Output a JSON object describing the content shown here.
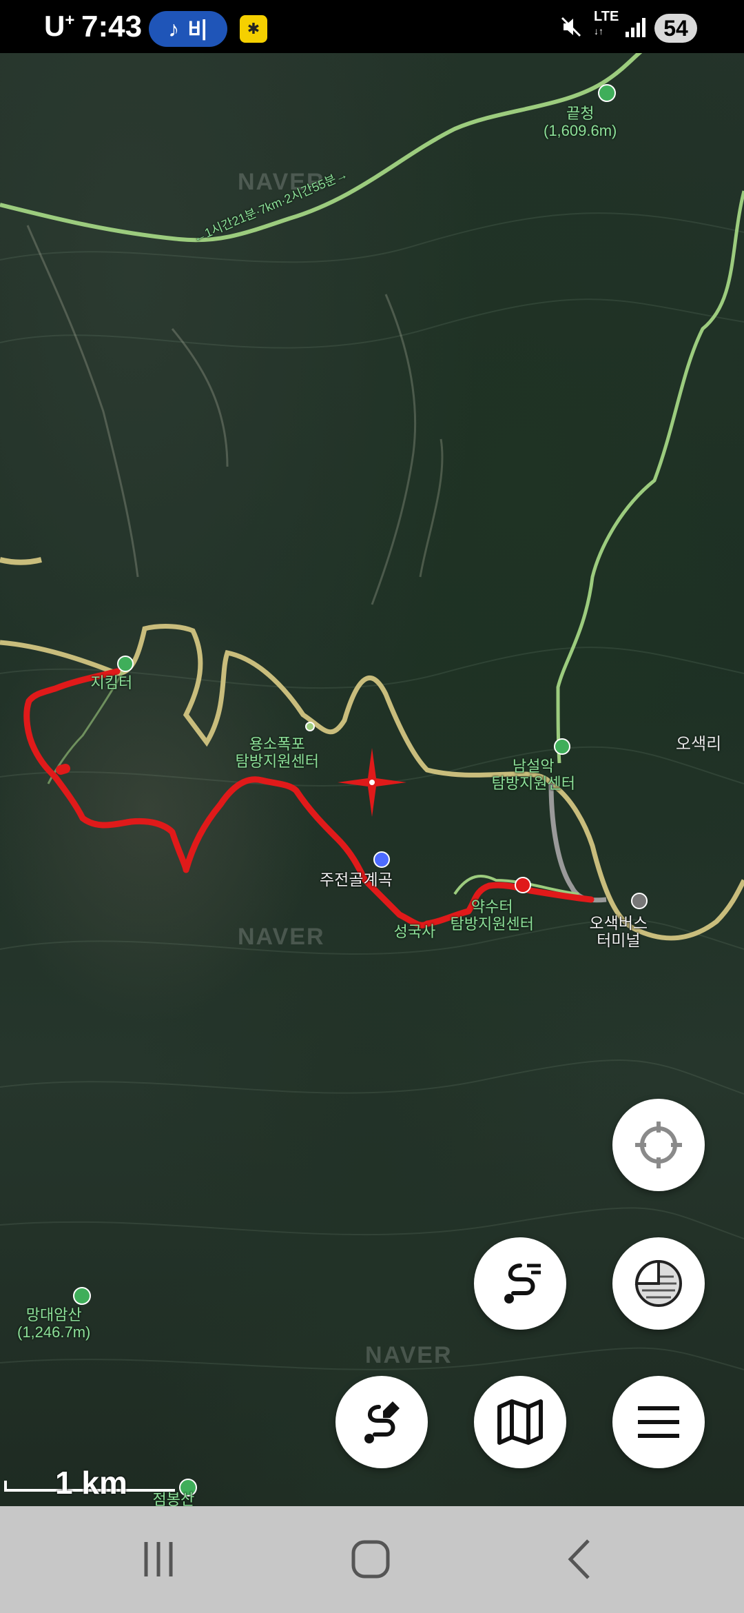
{
  "status_bar": {
    "carrier": "U",
    "carrier_sup": "+",
    "time": "7:43",
    "music_label": "비",
    "network": "LTE",
    "battery": "54"
  },
  "map": {
    "labels": {
      "peak_top": "끝청",
      "peak_top_elev": "(1,609.6m)",
      "trail_note": "←1시간21분·7km·2시간55분→",
      "jeombong_pass": "지킴터",
      "yongso_line1": "용소폭포",
      "yongso_line2": "탐방지원센터",
      "namseorak_line1": "남설악",
      "namseorak_line2": "탐방지원센터",
      "osaekri": "오색리",
      "jujeongol": "주전골계곡",
      "seongguksa": "성국사",
      "yaksuteo_line1": "약수터",
      "yaksuteo_line2": "탐방지원센터",
      "bus_line1": "오색버스",
      "bus_line2": "터미널",
      "mangdae_line1": "망대암산",
      "mangdae_line2": "(1,246.7m)",
      "bottom_peak": "점봉산",
      "watermark": "NAVER"
    },
    "scale": "1 km"
  },
  "buttons": {
    "locate": "locate-icon",
    "route_list": "route-list-icon",
    "layers": "layers-icon",
    "draw_route": "draw-route-icon",
    "map_view": "map-icon",
    "menu": "menu-icon"
  },
  "colors": {
    "route": "#e01a1a",
    "trail": "#9ccc7e",
    "road": "#c9bd7c"
  }
}
